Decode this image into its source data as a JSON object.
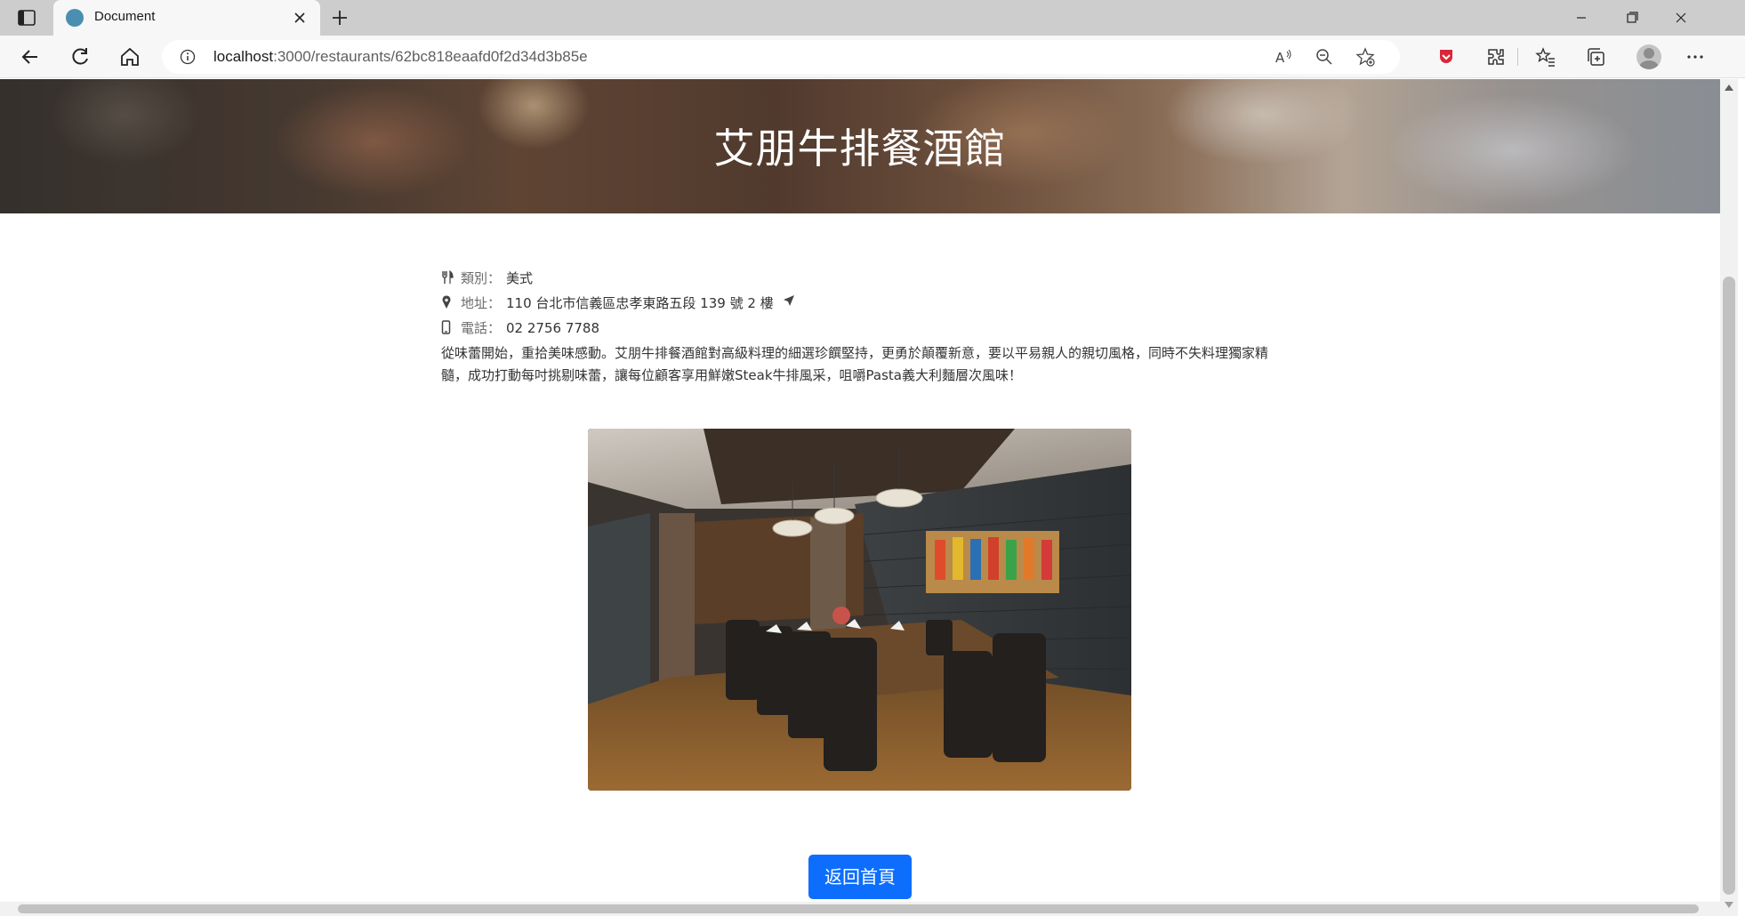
{
  "browser": {
    "tab_title": "Document",
    "url_host": "localhost",
    "url_path": ":3000/restaurants/62bc818eaafd0f2d34d3b85e",
    "icons": [
      "sidebar-toggle-icon",
      "close-icon",
      "plus-icon",
      "back-icon",
      "reload-icon",
      "home-icon",
      "info-icon",
      "read-aloud-icon",
      "zoom-icon",
      "favorite-add-icon",
      "shield-icon",
      "extensions-icon",
      "favorites-icon",
      "collections-icon",
      "profile-icon",
      "more-icon",
      "minimize-icon",
      "maximize-icon"
    ]
  },
  "restaurant": {
    "name": "艾朋牛排餐酒館",
    "category_label": "類別：",
    "category": "美式",
    "address_label": "地址：",
    "address": "110 台北市信義區忠孝東路五段 139 號 2 樓",
    "phone_label": "電話：",
    "phone": "02 2756 7788",
    "description": "從味蕾開始，重拾美味感動。艾朋牛排餐酒館對高級料理的細選珍饌堅持，更勇於顛覆新意，要以平易親人的親切風格，同時不失料理獨家精髓，成功打動每吋挑剔味蕾，讓每位顧客享用鮮嫩Steak牛排風采，咀嚼Pasta義大利麵層次風味！"
  },
  "actions": {
    "back_home": "返回首頁"
  },
  "colors": {
    "primary_button": "#0d6efd",
    "banner_title": "#ffffff"
  }
}
